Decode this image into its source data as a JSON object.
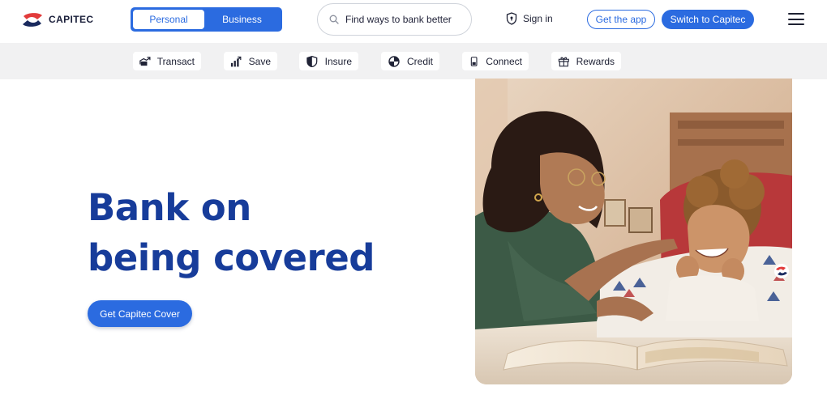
{
  "header": {
    "logo_text": "CAPITEC",
    "segment": {
      "personal": "Personal",
      "business": "Business",
      "selected": "Personal"
    },
    "search": {
      "placeholder": "Find ways to bank better"
    },
    "signin": "Sign in",
    "get_app": "Get the app",
    "switch": "Switch to Capitec"
  },
  "subnav": {
    "items": [
      {
        "label": "Transact",
        "icon": "transact-icon"
      },
      {
        "label": "Save",
        "icon": "save-icon"
      },
      {
        "label": "Insure",
        "icon": "insure-icon"
      },
      {
        "label": "Credit",
        "icon": "credit-icon"
      },
      {
        "label": "Connect",
        "icon": "connect-icon"
      },
      {
        "label": "Rewards",
        "icon": "rewards-icon"
      }
    ]
  },
  "hero": {
    "title_line1": "Bank on",
    "title_line2": "being covered",
    "cta": "Get Capitec Cover"
  },
  "colors": {
    "brand_blue": "#2b6be0",
    "headline_blue": "#173c9a",
    "logo_red": "#e23b3b",
    "logo_navy": "#1a2a5e",
    "subnav_bg": "#f1f1f2"
  }
}
